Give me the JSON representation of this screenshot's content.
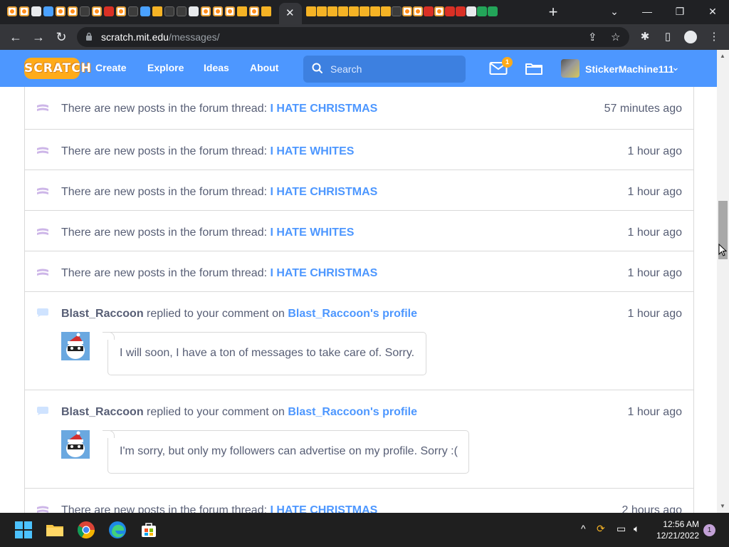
{
  "browser": {
    "url_host": "scratch.mit.edu",
    "url_path": "/messages/"
  },
  "nav": {
    "logo": "SCRATCH",
    "links": [
      "Create",
      "Explore",
      "Ideas",
      "About"
    ],
    "search_placeholder": "Search",
    "message_count": "1",
    "username": "StickerMachine111"
  },
  "messages": [
    {
      "type": "forum",
      "prefix": "There are new posts in the forum thread: ",
      "link": "I HATE CHRISTMAS",
      "time": "57 minutes ago"
    },
    {
      "type": "forum",
      "prefix": "There are new posts in the forum thread: ",
      "link": "I HATE WHITES",
      "time": "1 hour ago"
    },
    {
      "type": "forum",
      "prefix": "There are new posts in the forum thread: ",
      "link": "I HATE CHRISTMAS",
      "time": "1 hour ago"
    },
    {
      "type": "forum",
      "prefix": "There are new posts in the forum thread: ",
      "link": "I HATE WHITES",
      "time": "1 hour ago"
    },
    {
      "type": "forum",
      "prefix": "There are new posts in the forum thread: ",
      "link": "I HATE CHRISTMAS",
      "time": "1 hour ago"
    },
    {
      "type": "comment",
      "user": "Blast_Raccoon",
      "middle": " replied to your comment on ",
      "link": "Blast_Raccoon's profile",
      "time": "1 hour ago",
      "comment": "I will soon, I have a ton of messages to take care of. Sorry."
    },
    {
      "type": "comment",
      "user": "Blast_Raccoon",
      "middle": " replied to your comment on ",
      "link": "Blast_Raccoon's profile",
      "time": "1 hour ago",
      "comment": "I'm sorry, but only my followers can advertise on my profile. Sorry :("
    },
    {
      "type": "forum",
      "prefix": "There are new posts in the forum thread: ",
      "link": "I HATE CHRISTMAS",
      "time": "2 hours ago"
    }
  ],
  "taskbar": {
    "time": "12:56 AM",
    "date": "12/21/2022",
    "notifications": "1"
  },
  "colors": {
    "scratch_blue": "#4d97ff",
    "scratch_orange": "#ffab19",
    "text_gray": "#575e75"
  },
  "icons": {
    "forum_row": "forum-icon",
    "comment_row": "comment-icon"
  }
}
